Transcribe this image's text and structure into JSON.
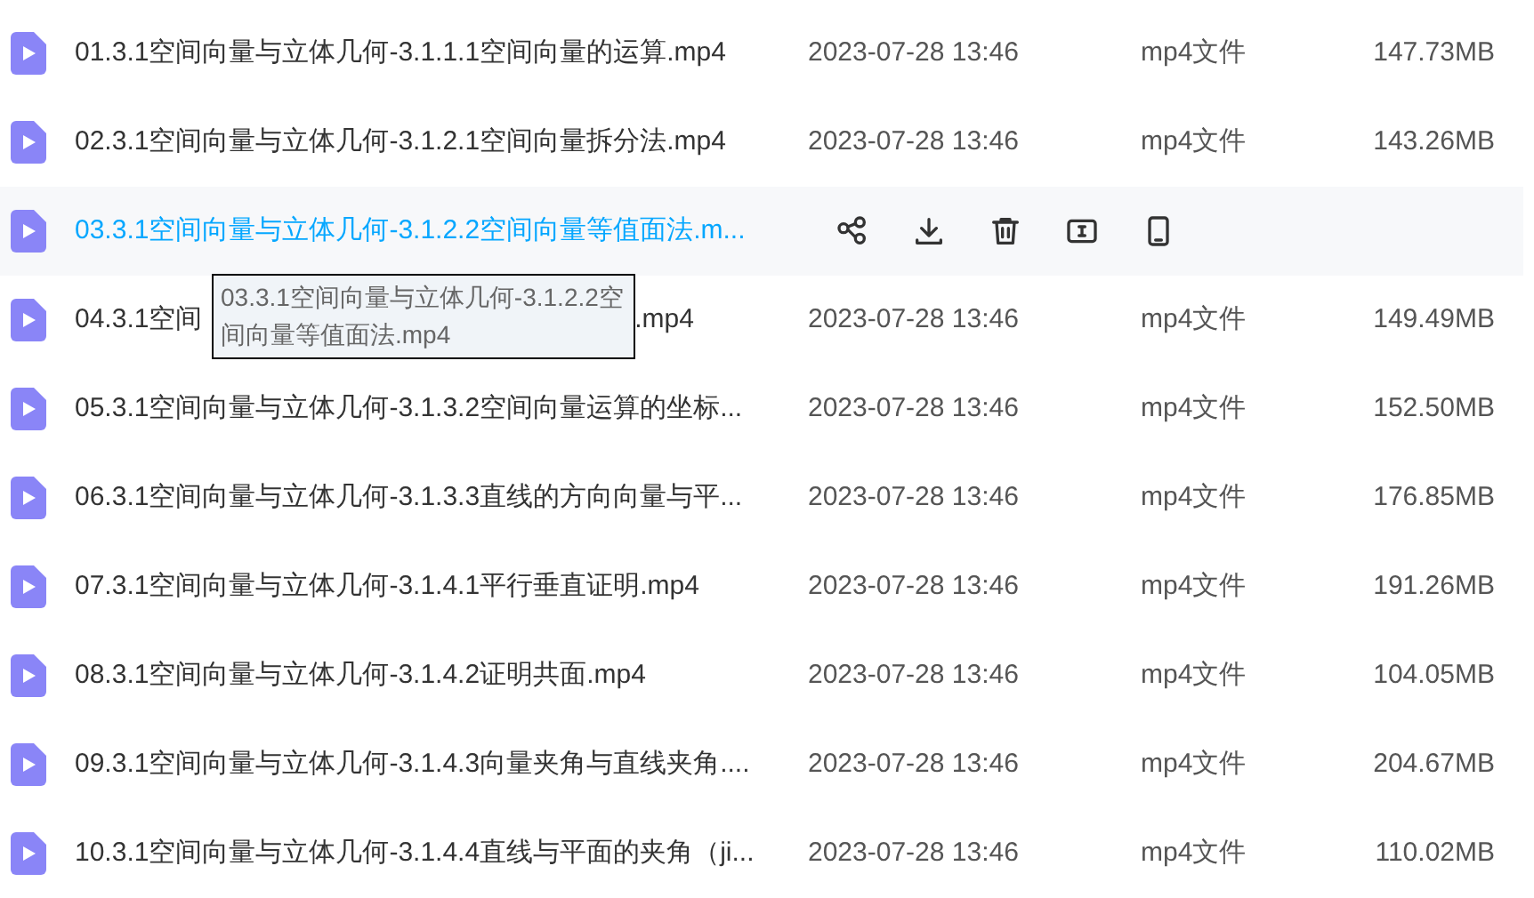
{
  "files": [
    {
      "name": "01.3.1空间向量与立体几何-3.1.1.1空间向量的运算.mp4",
      "date": "2023-07-28 13:46",
      "type": "mp4文件",
      "size": "147.73MB",
      "hovered": false
    },
    {
      "name": "02.3.1空间向量与立体几何-3.1.2.1空间向量拆分法.mp4",
      "date": "2023-07-28 13:46",
      "type": "mp4文件",
      "size": "143.26MB",
      "hovered": false
    },
    {
      "name": "03.3.1空间向量与立体几何-3.1.2.2空间向量等值面法.m...",
      "hovered": true
    },
    {
      "name_parts": [
        "04.3.1空间",
        ".mp4"
      ],
      "date": "2023-07-28 13:46",
      "type": "mp4文件",
      "size": "149.49MB",
      "hovered": false
    },
    {
      "name": "05.3.1空间向量与立体几何-3.1.3.2空间向量运算的坐标...",
      "date": "2023-07-28 13:46",
      "type": "mp4文件",
      "size": "152.50MB",
      "hovered": false
    },
    {
      "name": "06.3.1空间向量与立体几何-3.1.3.3直线的方向向量与平...",
      "date": "2023-07-28 13:46",
      "type": "mp4文件",
      "size": "176.85MB",
      "hovered": false
    },
    {
      "name": "07.3.1空间向量与立体几何-3.1.4.1平行垂直证明.mp4",
      "date": "2023-07-28 13:46",
      "type": "mp4文件",
      "size": "191.26MB",
      "hovered": false
    },
    {
      "name": "08.3.1空间向量与立体几何-3.1.4.2证明共面.mp4",
      "date": "2023-07-28 13:46",
      "type": "mp4文件",
      "size": "104.05MB",
      "hovered": false
    },
    {
      "name": "09.3.1空间向量与立体几何-3.1.4.3向量夹角与直线夹角....",
      "date": "2023-07-28 13:46",
      "type": "mp4文件",
      "size": "204.67MB",
      "hovered": false
    },
    {
      "name": "10.3.1空间向量与立体几何-3.1.4.4直线与平面的夹角（ji...",
      "date": "2023-07-28 13:46",
      "type": "mp4文件",
      "size": "110.02MB",
      "hovered": false
    }
  ],
  "tooltip": {
    "text": "03.3.1空间向量与立体几何-3.1.2.2空间向量等值面法.mp4"
  }
}
